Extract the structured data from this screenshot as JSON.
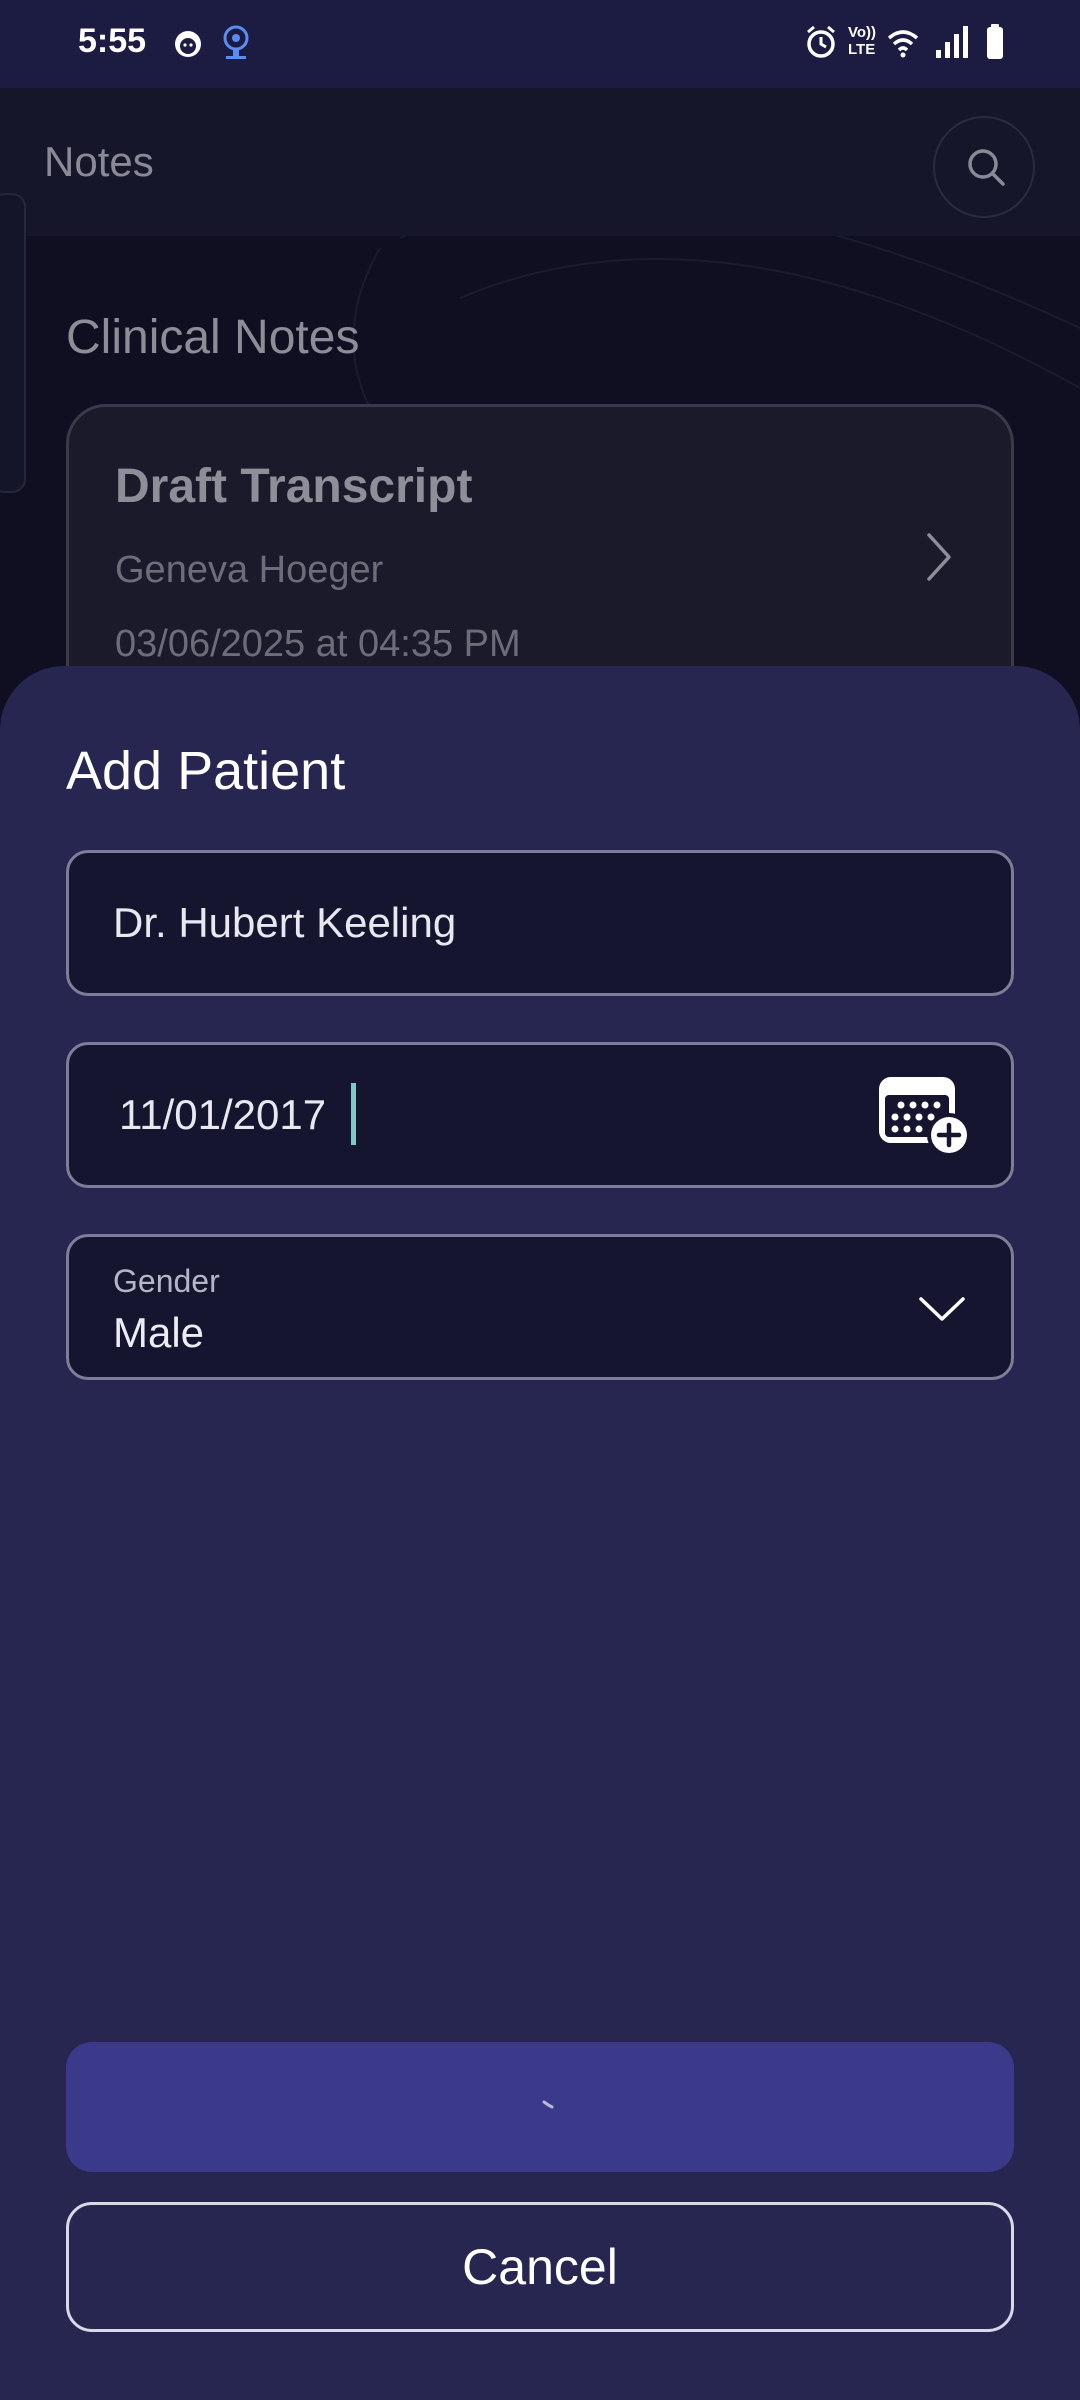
{
  "status_bar": {
    "time": "5:55",
    "icons_left": [
      "face-icon",
      "podcast-icon"
    ],
    "icons_right": [
      "alarm-icon",
      "volte-icon",
      "wifi-icon",
      "signal-icon",
      "battery-icon"
    ],
    "volte_label_top": "Vo))",
    "volte_label_bottom": "LTE"
  },
  "background": {
    "app_title": "Notes",
    "section_title": "Clinical Notes",
    "card": {
      "title": "Draft Transcript",
      "name": "Geneva Hoeger",
      "date": "03/06/2025 at 04:35 PM"
    }
  },
  "sheet": {
    "title": "Add Patient",
    "name_field": {
      "value": "Dr. Hubert Keeling"
    },
    "dob_field": {
      "value": "11/01/2017"
    },
    "gender_field": {
      "label": "Gender",
      "value": "Male"
    },
    "primary_button": {
      "state": "loading"
    },
    "cancel_label": "Cancel"
  },
  "colors": {
    "sheet_bg": "#262650",
    "field_bg": "#15152f",
    "primary_button": "#3b3a8a",
    "caret": "#7ec9c7"
  }
}
